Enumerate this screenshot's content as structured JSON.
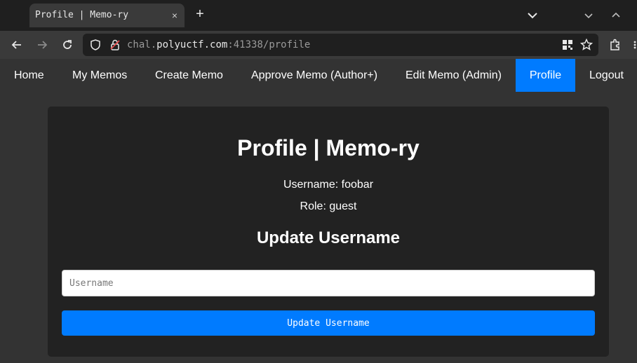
{
  "browser": {
    "tab_title": "Profile | Memo-ry",
    "tab_close": "×",
    "new_tab": "+",
    "url": {
      "prefix": "chal.",
      "host": "polyuctf.com",
      "suffix": ":41338/profile"
    }
  },
  "nav": {
    "items": [
      {
        "label": "Home"
      },
      {
        "label": "My Memos"
      },
      {
        "label": "Create Memo"
      },
      {
        "label": "Approve Memo (Author+)"
      },
      {
        "label": "Edit Memo (Admin)"
      },
      {
        "label": "Profile"
      },
      {
        "label": "Logout"
      }
    ],
    "active": "Profile"
  },
  "profile": {
    "title": "Profile | Memo-ry",
    "username_line": "Username: foobar",
    "role_line": "Role: guest",
    "update_heading": "Update Username",
    "input_placeholder": "Username",
    "input_value": "",
    "submit_label": "Update Username"
  },
  "colors": {
    "accent": "#007bff",
    "page_bg": "#333333",
    "card_bg": "#222222"
  }
}
